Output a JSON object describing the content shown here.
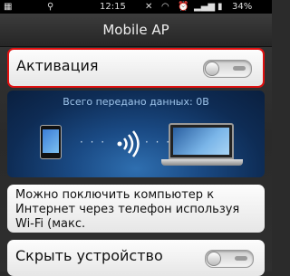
{
  "status_bar": {
    "usb_icon": "usb-icon",
    "time": "12:15",
    "battery_percent": "34%"
  },
  "header": {
    "title": "Mobile AP"
  },
  "activation": {
    "label": "Активация",
    "enabled": false
  },
  "transfer": {
    "total_text": "Всего передано данных: 0В"
  },
  "info": {
    "text": "Можно поключить компьютер к Интернет через телефон используя Wi-Fi (макс."
  },
  "hide_device": {
    "label": "Скрыть устройство",
    "enabled": false
  }
}
